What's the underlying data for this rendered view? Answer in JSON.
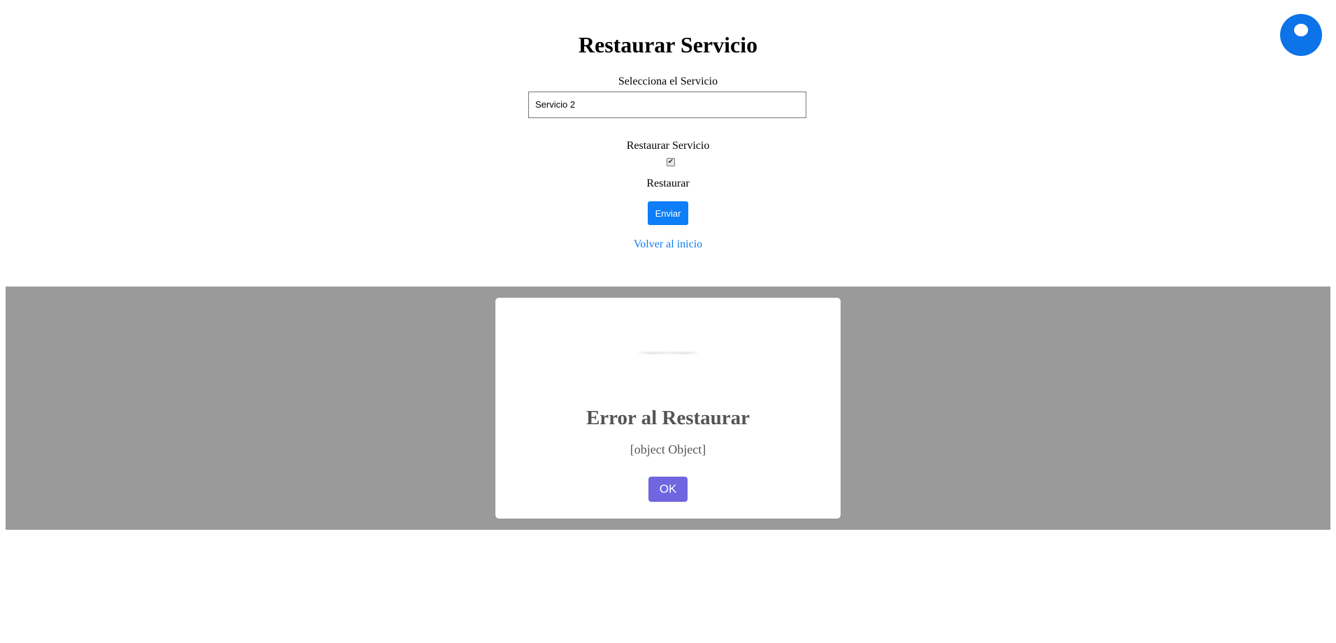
{
  "page": {
    "title": "Restaurar Servicio"
  },
  "form": {
    "service_label": "Selecciona el Servicio",
    "service_value": "Servicio 2",
    "restore_check_label": "Restaurar Servicio",
    "restore_checked": true,
    "checkbox_glyph": "✔",
    "restore_text": "Restaurar",
    "submit_label": "Enviar",
    "back_link": "Volver al inicio"
  },
  "modal": {
    "title": "Error al Restaurar",
    "message": "[object Object]",
    "ok_label": "OK"
  },
  "colors": {
    "primary_blue": "#0d7ef7",
    "corner_circle": "#0d73e8",
    "overlay": "#9a9a9a",
    "modal_button": "#7066e0",
    "modal_text": "#545454"
  }
}
